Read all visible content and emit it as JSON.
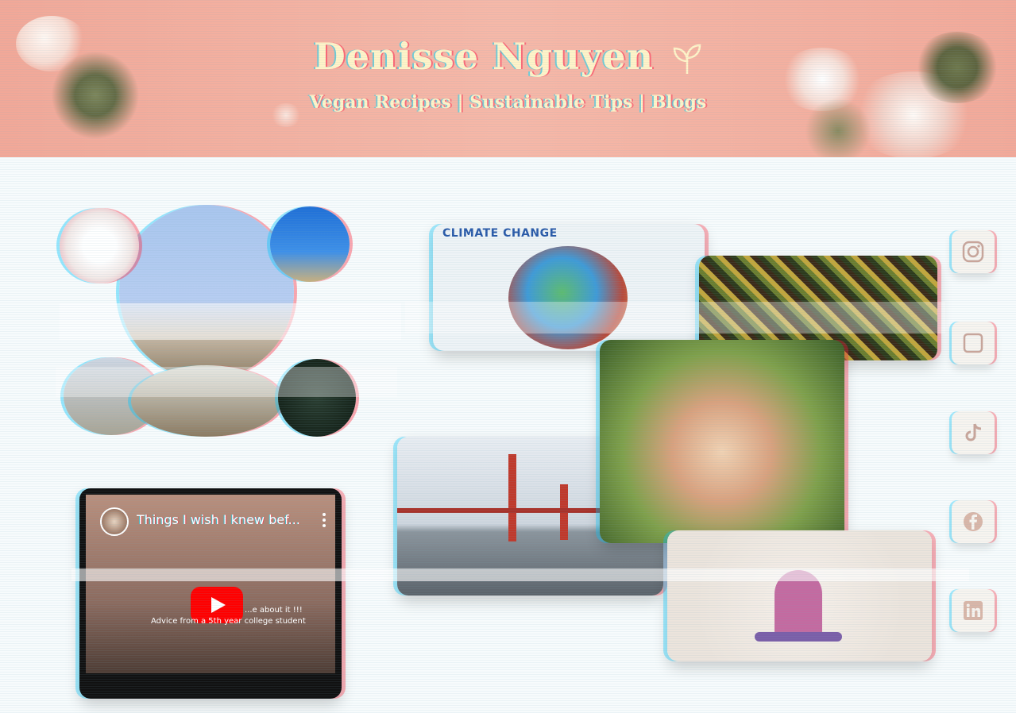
{
  "header": {
    "site_title": "Denisse Nguyen",
    "nav": {
      "recipes": "Vegan Recipes",
      "tips": "Sustainable Tips",
      "blogs": "Blogs",
      "separator": "|"
    }
  },
  "gallery": {
    "climate_card": {
      "title": "CLIMATE CHANGE"
    },
    "video": {
      "title": "Things I wish I knew bef...",
      "subtitle_line1": "...e about it !!!",
      "subtitle_line2": "Advice from a 5th year college student"
    }
  },
  "social": [
    {
      "icon": "instagram-icon"
    },
    {
      "icon": "square-icon"
    },
    {
      "icon": "tiktok-icon"
    },
    {
      "icon": "facebook-icon"
    },
    {
      "icon": "linkedin-icon"
    }
  ],
  "colors": {
    "banner": "#f4ad9c",
    "title_text": "#fff3c8",
    "youtube_red": "#ff0000"
  }
}
